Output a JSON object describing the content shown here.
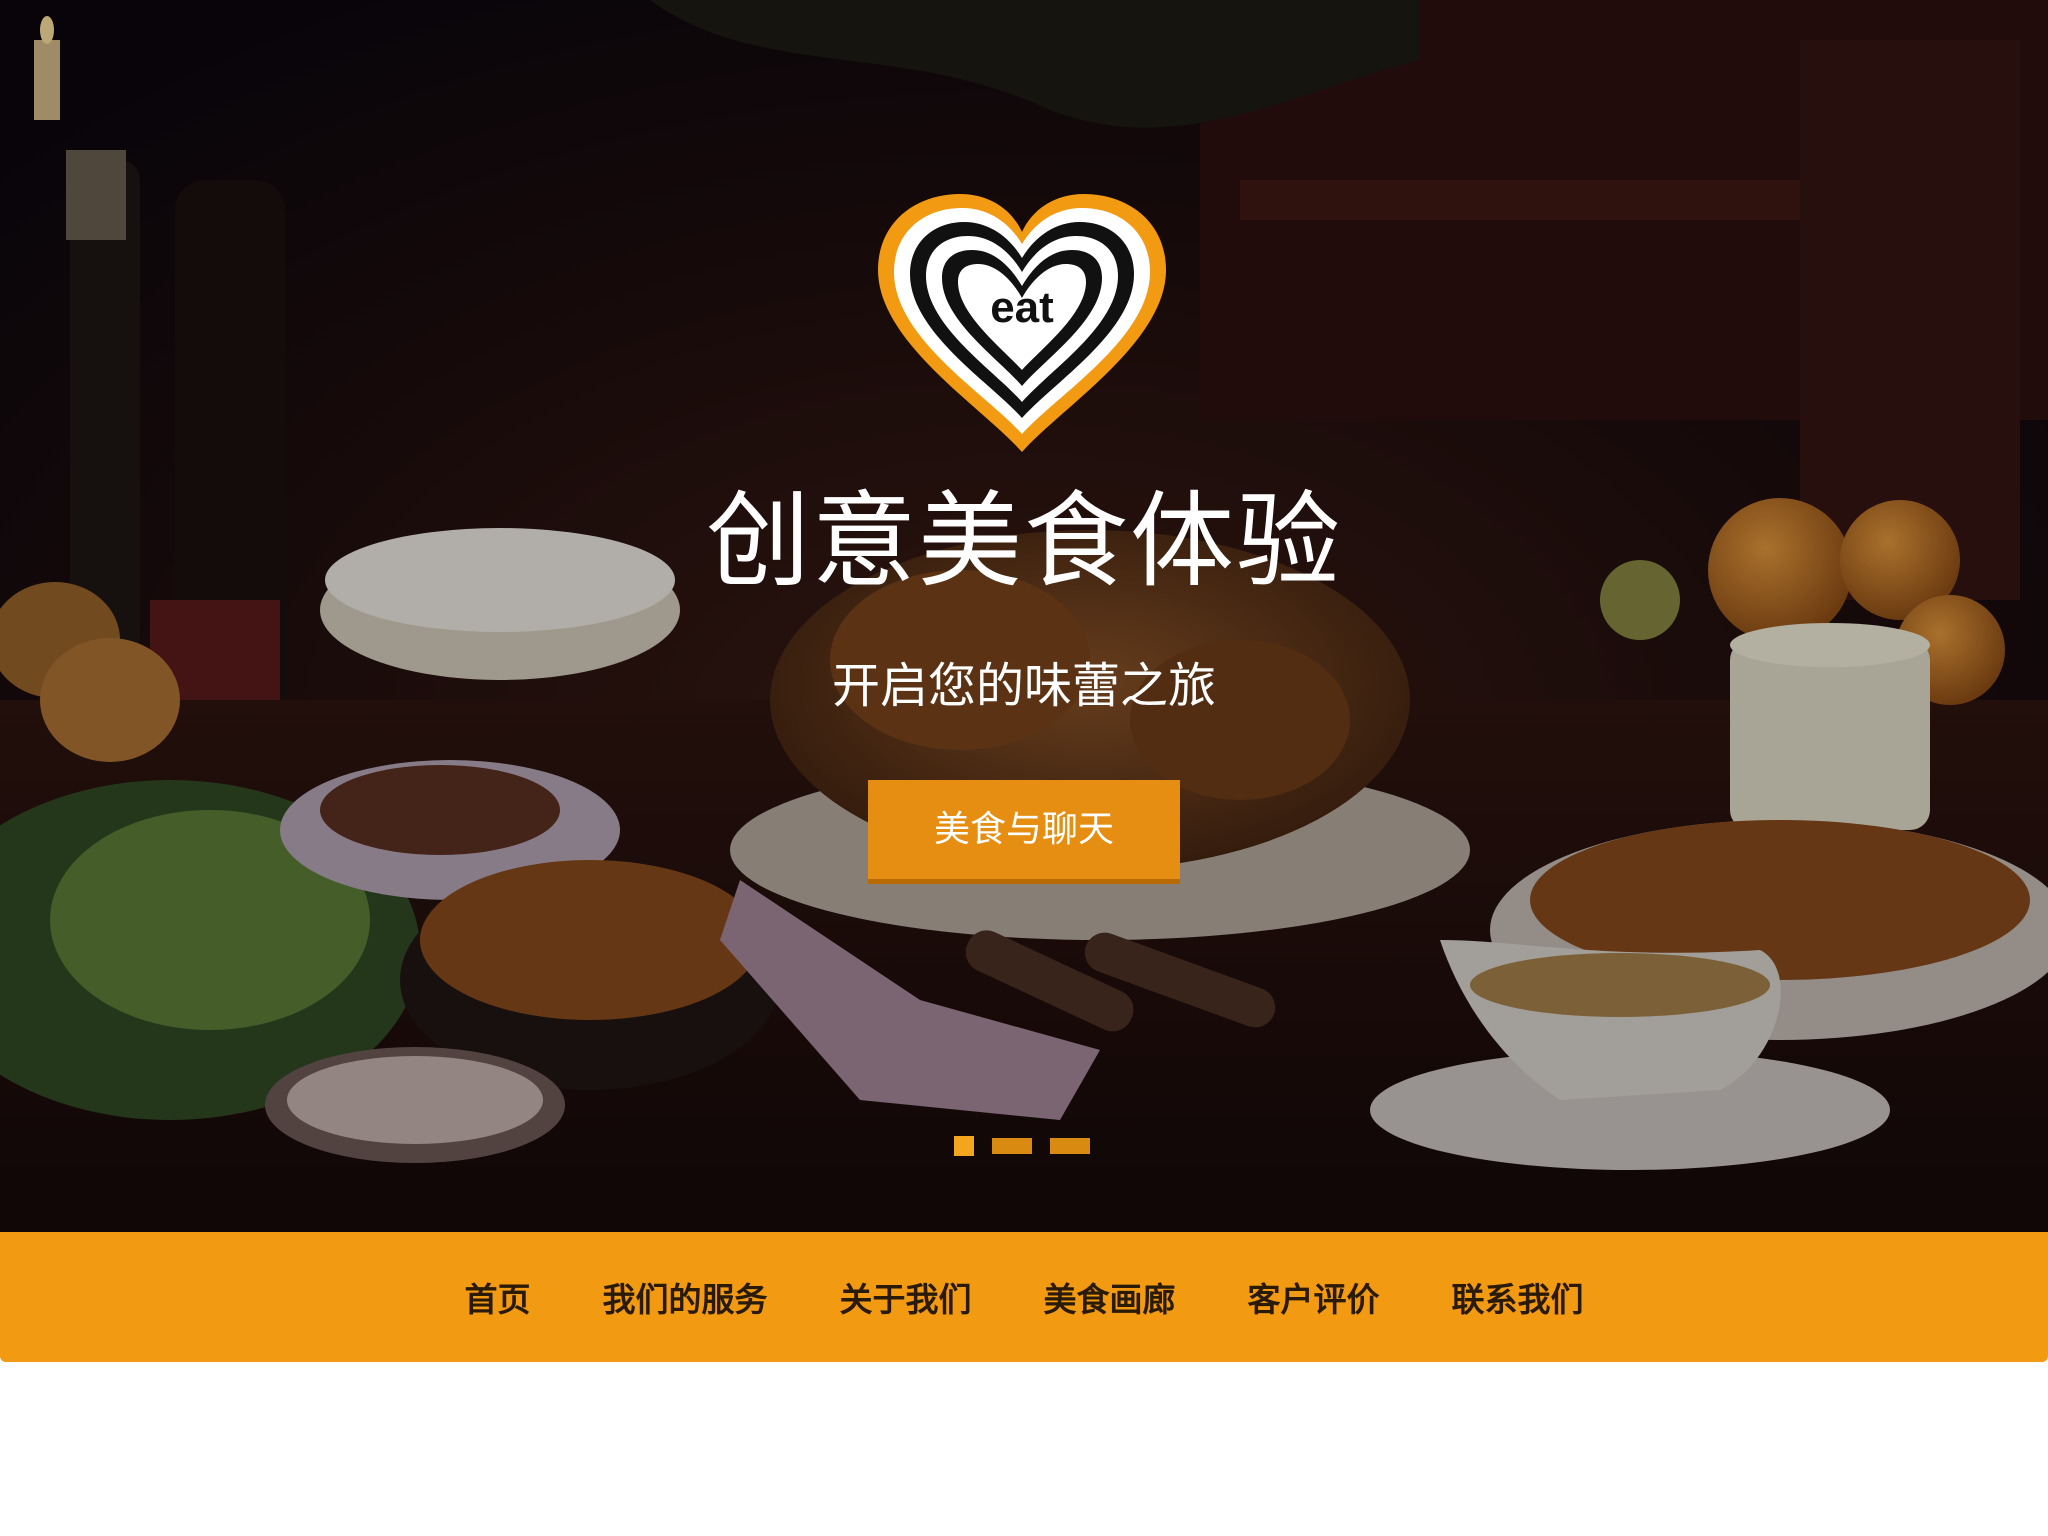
{
  "hero": {
    "logo_text": "eat",
    "title": "创意美食体验",
    "subtitle": "开启您的味蕾之旅",
    "cta_label": "美食与聊天",
    "slides": [
      {
        "active": true
      },
      {
        "active": false
      },
      {
        "active": false
      }
    ]
  },
  "nav": {
    "items": [
      {
        "label": "首页"
      },
      {
        "label": "我们的服务"
      },
      {
        "label": "关于我们"
      },
      {
        "label": "美食画廊"
      },
      {
        "label": "客户评价"
      },
      {
        "label": "联系我们"
      }
    ]
  },
  "colors": {
    "accent": "#f29a12",
    "button": "#e58e12",
    "nav_text": "#2a1a08",
    "hero_text": "#ffffff"
  },
  "icons": {
    "logo": "heart-eat-logo-icon"
  }
}
